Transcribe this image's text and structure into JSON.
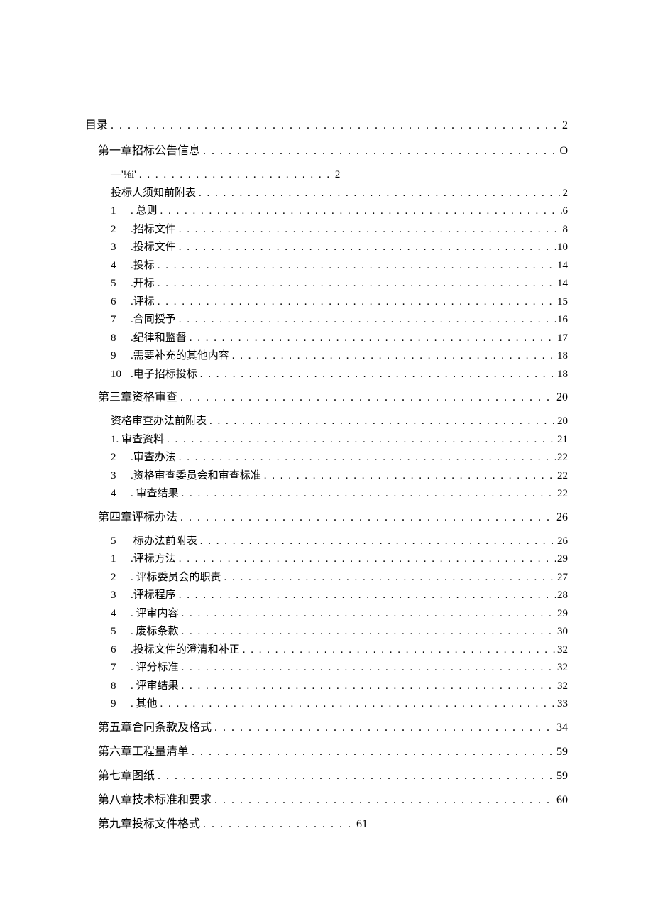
{
  "entries": [
    {
      "level": 0,
      "num": "",
      "label": "目录",
      "page": "2",
      "style": ""
    },
    {
      "level": 1,
      "num": "",
      "label": "第一章招标公告信息",
      "page": "O",
      "style": ""
    },
    {
      "level": 2,
      "num": "",
      "label": "—'⅛i'",
      "page": "2",
      "style": "short"
    },
    {
      "level": 2,
      "num": "",
      "label": "投标人须知前附表",
      "page": "2",
      "style": ""
    },
    {
      "level": 3,
      "num": "1",
      "label": ". 总则",
      "page": "6",
      "style": ""
    },
    {
      "level": 3,
      "num": "2",
      "label": ".招标文件",
      "page": "8",
      "style": ""
    },
    {
      "level": 3,
      "num": "3",
      "label": ".投标文件",
      "page": "10",
      "style": ""
    },
    {
      "level": 3,
      "num": "4",
      "label": ".投标",
      "page": "14",
      "style": ""
    },
    {
      "level": 3,
      "num": "5",
      "label": ".开标",
      "page": "14",
      "style": ""
    },
    {
      "level": 3,
      "num": "6",
      "label": ".评标",
      "page": "15",
      "style": ""
    },
    {
      "level": 3,
      "num": "7",
      "label": ".合同授予",
      "page": "16",
      "style": ""
    },
    {
      "level": 3,
      "num": "8",
      "label": ".纪律和监督",
      "page": "17",
      "style": ""
    },
    {
      "level": 3,
      "num": "9",
      "label": ".需要补充的其他内容",
      "page": "18",
      "style": ""
    },
    {
      "level": 3,
      "num": "10",
      "label": ".电子招标投标",
      "page": "18",
      "style": ""
    },
    {
      "level": 1,
      "num": "",
      "label": "第三章资格审查",
      "page": "20",
      "style": ""
    },
    {
      "level": 2,
      "num": "",
      "label": "资格审查办法前附表",
      "page": "20",
      "style": ""
    },
    {
      "level": 3,
      "num": "",
      "label": "1. 审查资料",
      "page": "21",
      "style": ""
    },
    {
      "level": 3,
      "num": "2",
      "label": ".审查办法",
      "page": "22",
      "style": ""
    },
    {
      "level": 3,
      "num": "3",
      "label": ".资格审查委员会和审查标准",
      "page": "22",
      "style": ""
    },
    {
      "level": 3,
      "num": "4",
      "label": ". 审查结果",
      "page": "22",
      "style": ""
    },
    {
      "level": 1,
      "num": "",
      "label": "第四章评标办法",
      "page": "26",
      "style": ""
    },
    {
      "level": 3,
      "num": "5",
      "label": "   标办法前附表",
      "page": "26",
      "style": ""
    },
    {
      "level": 3,
      "num": "1",
      "label": ".评标方法",
      "page": "29",
      "style": ""
    },
    {
      "level": 3,
      "num": "2",
      "label": ". 评标委员会的职责",
      "page": "27",
      "style": ""
    },
    {
      "level": 3,
      "num": "3",
      "label": ".评标程序",
      "page": "28",
      "style": ""
    },
    {
      "level": 3,
      "num": "4",
      "label": ". 评审内容",
      "page": "29",
      "style": ""
    },
    {
      "level": 3,
      "num": "5",
      "label": ". 废标条款",
      "page": "30",
      "style": ""
    },
    {
      "level": 3,
      "num": "6",
      "label": ".投标文件的澄清和补正",
      "page": "32",
      "style": ""
    },
    {
      "level": 3,
      "num": "7",
      "label": ". 评分标准",
      "page": "32",
      "style": ""
    },
    {
      "level": 3,
      "num": "8",
      "label": ". 评审结果",
      "page": "32",
      "style": ""
    },
    {
      "level": 3,
      "num": "9",
      "label": ". 其他",
      "page": "33",
      "style": ""
    },
    {
      "level": 1,
      "num": "",
      "label": "第五章合同条款及格式",
      "page": "34",
      "style": ""
    },
    {
      "level": 1,
      "num": "",
      "label": "第六章工程量清单",
      "page": "59",
      "style": ""
    },
    {
      "level": 1,
      "num": "",
      "label": "第七章图纸",
      "page": "59",
      "style": ""
    },
    {
      "level": 1,
      "num": "",
      "label": "第八章技术标准和要求",
      "page": "60",
      "style": ""
    },
    {
      "level": 1,
      "num": "",
      "label": "第九章投标文件格式",
      "page": "61",
      "style": "medium"
    }
  ]
}
